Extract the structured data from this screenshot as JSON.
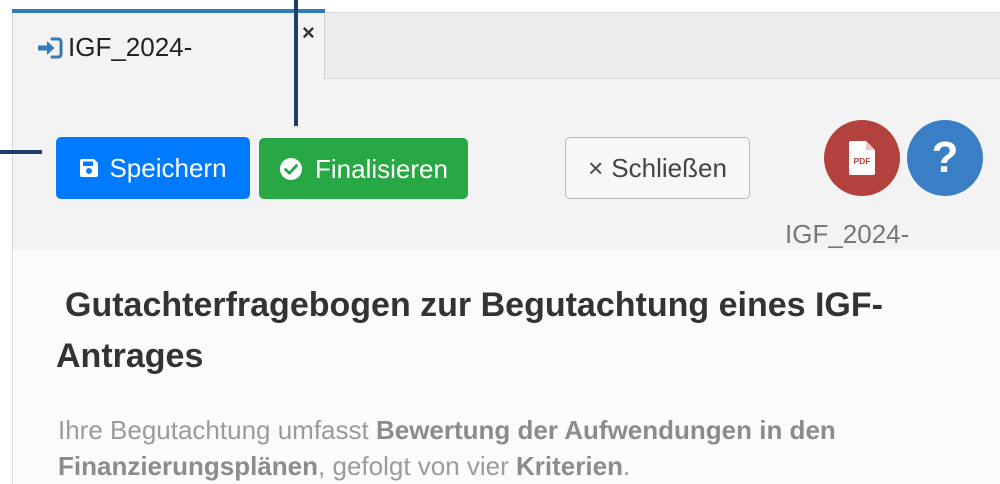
{
  "tab": {
    "title": "IGF_2024-",
    "icon": "sign-in-icon",
    "close_symbol": "×"
  },
  "toolbar": {
    "save_icon": "save-icon",
    "save_label": "Speichern",
    "finalize_icon": "check-circle-icon",
    "finalize_label": "Finalisieren",
    "close_symbol": "×",
    "close_label": "Schließen",
    "pdf_icon": "file-pdf-icon",
    "pdf_icon_text": "PDF",
    "help_icon": "question-icon",
    "help_label": "?",
    "document_id": "IGF_2024-"
  },
  "content": {
    "heading": "Gutachterfragebogen zur Begutachtung eines IGF-Antrages",
    "intro": {
      "part1": "Ihre Begutachtung umfasst ",
      "part2_bold": "Bewertung der Aufwendungen in den Finanzierungsplänen",
      "part3": ", gefolgt von vier ",
      "part4_bold": "Kriterien",
      "part5": "."
    }
  },
  "colors": {
    "tab_accent": "#337ab7",
    "save_button": "#007bff",
    "finalize_button": "#28a745",
    "pdf_button": "#b3423e",
    "help_button": "#3a7fc6",
    "annotation": "#1f3d6b"
  }
}
